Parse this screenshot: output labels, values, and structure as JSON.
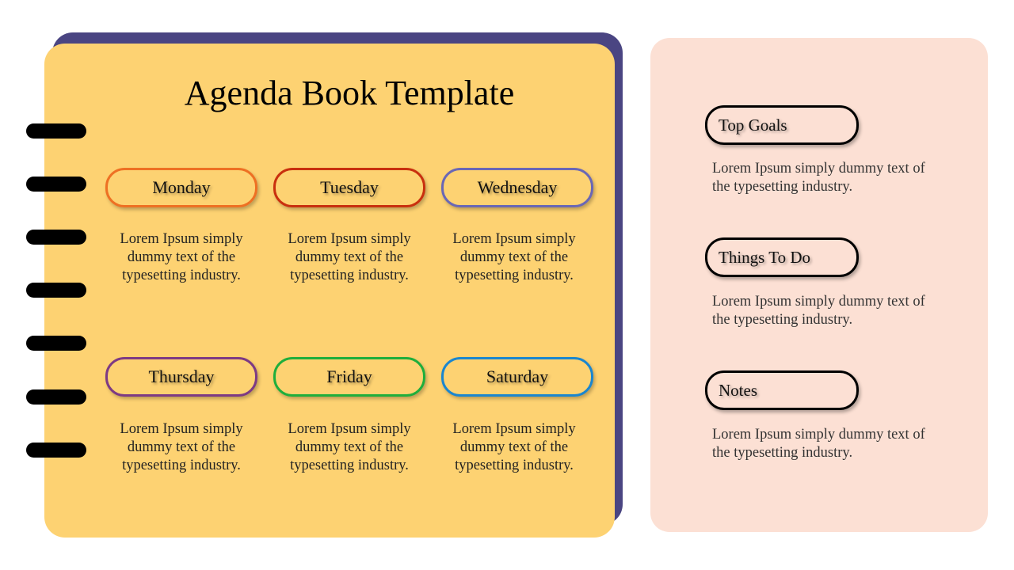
{
  "title": "Agenda Book Template",
  "colors": {
    "book_back": "#4a4582",
    "book_page": "#fdd272",
    "side_panel": "#fce0d4",
    "ring": "#000000"
  },
  "days": [
    {
      "label": "Monday",
      "color": "#ee7023",
      "text": "Lorem Ipsum simply dummy text of the typesetting industry."
    },
    {
      "label": "Tuesday",
      "color": "#c9300e",
      "text": "Lorem Ipsum simply dummy text of the typesetting industry."
    },
    {
      "label": "Wednesday",
      "color": "#6a67b5",
      "text": "Lorem Ipsum simply dummy text of the typesetting industry."
    },
    {
      "label": "Thursday",
      "color": "#7d3a84",
      "text": "Lorem Ipsum simply dummy text of the typesetting industry."
    },
    {
      "label": "Friday",
      "color": "#1fae3c",
      "text": "Lorem Ipsum simply dummy text of the typesetting industry."
    },
    {
      "label": "Saturday",
      "color": "#1a86cf",
      "text": "Lorem Ipsum simply dummy text of the typesetting industry."
    }
  ],
  "sections": [
    {
      "label": "Top Goals",
      "text": "Lorem Ipsum simply dummy text of the typesetting industry."
    },
    {
      "label": "Things To Do",
      "text": "Lorem Ipsum simply dummy text of the typesetting industry."
    },
    {
      "label": "Notes",
      "text": "Lorem Ipsum simply dummy text of the typesetting industry."
    }
  ]
}
